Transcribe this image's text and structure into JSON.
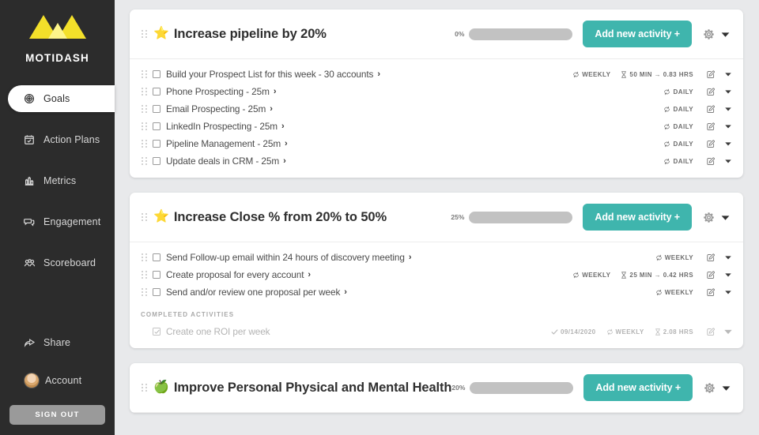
{
  "brand": {
    "name": "MOTIDASH",
    "logo_icon": "mountain-logo"
  },
  "sidebar": {
    "items": [
      {
        "label": "Goals",
        "icon": "goals-icon",
        "active": true
      },
      {
        "label": "Action Plans",
        "icon": "calendar-check-icon",
        "active": false
      },
      {
        "label": "Metrics",
        "icon": "bar-chart-icon",
        "active": false
      },
      {
        "label": "Engagement",
        "icon": "chat-bubbles-icon",
        "active": false
      },
      {
        "label": "Scoreboard",
        "icon": "scoreboard-icon",
        "active": false
      }
    ],
    "bottom": [
      {
        "label": "Share",
        "icon": "share-icon"
      },
      {
        "label": "Account",
        "icon": "avatar"
      }
    ],
    "sign_out_label": "SIGN OUT"
  },
  "colors": {
    "accent_teal": "#3fb5ad",
    "sidebar_bg": "#2c2c2c",
    "page_bg": "#e8e9eb",
    "logo_yellow": "#f5e029",
    "progress_track": "#c2c2c2"
  },
  "common": {
    "add_activity_label": "Add new activity +",
    "completed_header": "COMPLETED ACTIVITIES"
  },
  "goals": [
    {
      "emoji": "⭐",
      "emoji_name": "star-icon",
      "title": "Increase pipeline by 20%",
      "progress_label": "0%",
      "progress_value": 0,
      "activities": [
        {
          "label": "Build your Prospect List for this week - 30 accounts",
          "cadence": "WEEKLY",
          "duration": "50 MIN → 0.83 HRS",
          "done": false
        },
        {
          "label": "Phone Prospecting - 25m",
          "cadence": "DAILY",
          "duration": "",
          "done": false
        },
        {
          "label": "Email Prospecting - 25m",
          "cadence": "DAILY",
          "duration": "",
          "done": false
        },
        {
          "label": "LinkedIn Prospecting - 25m",
          "cadence": "DAILY",
          "duration": "",
          "done": false
        },
        {
          "label": "Pipeline Management - 25m",
          "cadence": "DAILY",
          "duration": "",
          "done": false
        },
        {
          "label": "Update deals in CRM - 25m",
          "cadence": "DAILY",
          "duration": "",
          "done": false
        }
      ],
      "completed": []
    },
    {
      "emoji": "⭐",
      "emoji_name": "star-icon",
      "title": "Increase Close % from 20% to 50%",
      "progress_label": "25%",
      "progress_value": 25,
      "activities": [
        {
          "label": "Send Follow-up email within 24 hours of discovery meeting",
          "cadence": "WEEKLY",
          "duration": "",
          "done": false
        },
        {
          "label": "Create proposal for every account",
          "cadence": "WEEKLY",
          "duration": "25 MIN → 0.42 HRS",
          "done": false
        },
        {
          "label": "Send and/or review one proposal per week",
          "cadence": "WEEKLY",
          "duration": "",
          "done": false
        }
      ],
      "completed": [
        {
          "label": "Create one ROI per week",
          "date": "09/14/2020",
          "cadence": "WEEKLY",
          "duration": "2.08 HRS",
          "done": true
        }
      ]
    },
    {
      "emoji": "🍏",
      "emoji_name": "apple-icon",
      "title": "Improve Personal Physical and Mental Health",
      "progress_label": "20%",
      "progress_value": 20,
      "activities": [],
      "completed": []
    }
  ]
}
